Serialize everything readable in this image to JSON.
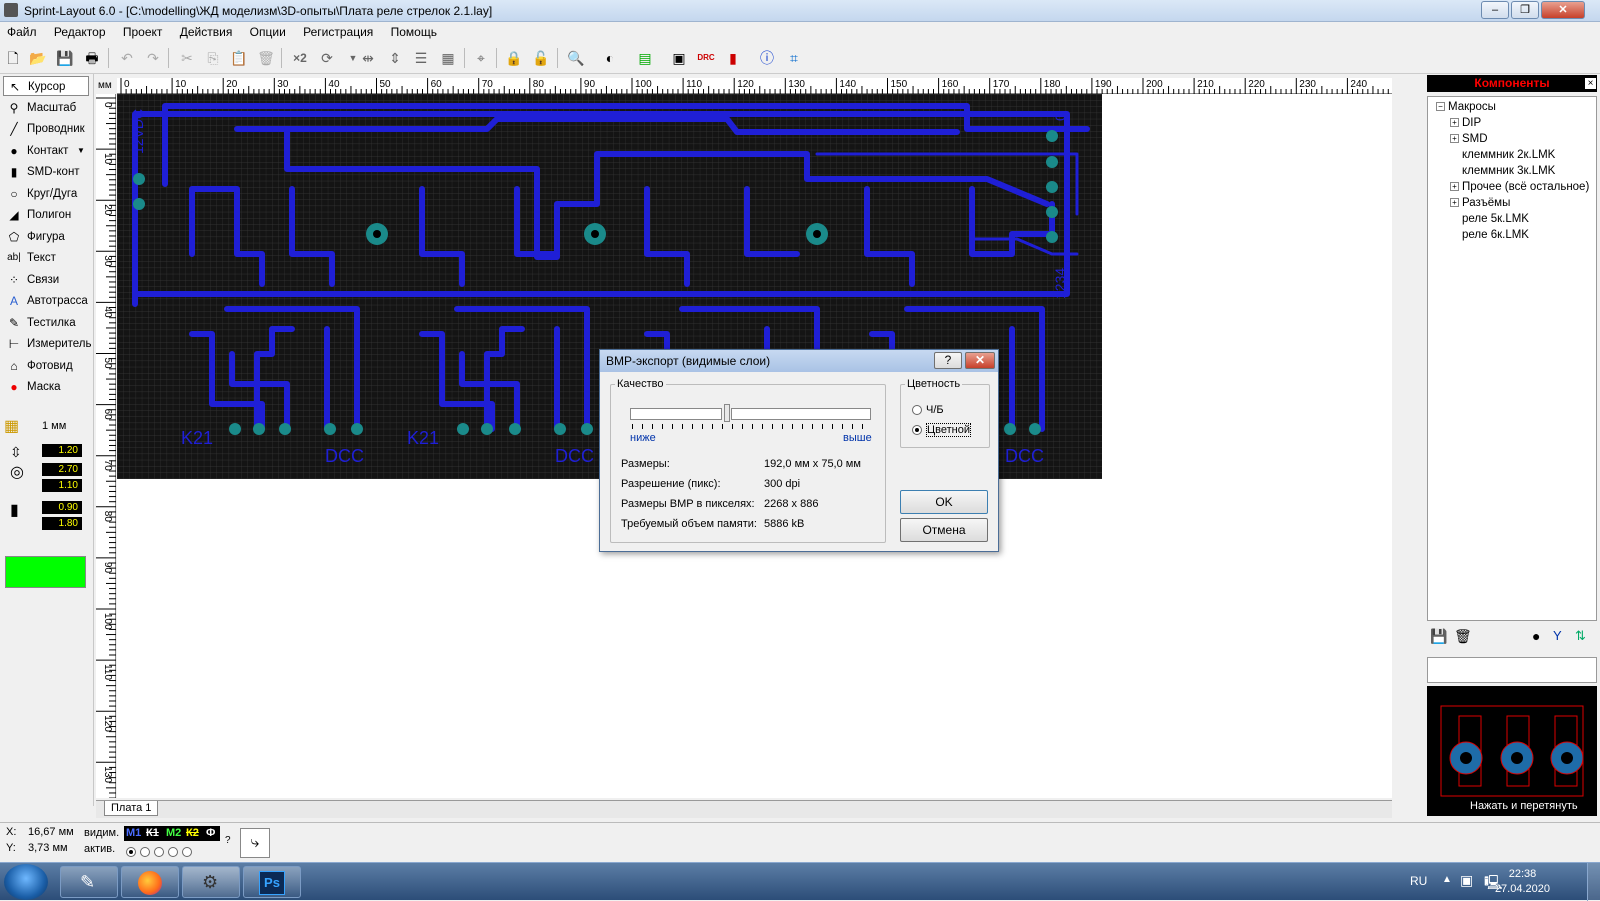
{
  "window": {
    "title": "Sprint-Layout 6.0 - [C:\\modelling\\ЖД моделизм\\3D-опыты\\Плата реле стрелок 2.1.lay]"
  },
  "menu": [
    "Файл",
    "Редактор",
    "Проект",
    "Действия",
    "Опции",
    "Регистрация",
    "Помощь"
  ],
  "toolbar": {
    "x2_label": "×2"
  },
  "tools": [
    "Курсор",
    "Масштаб",
    "Проводник",
    "Контакт",
    "SMD-конт",
    "Круг/Дуга",
    "Полигон",
    "Фигура",
    "Текст",
    "Связи",
    "Автотрасса",
    "Тестилка",
    "Измеритель",
    "Фотовид",
    "Маска"
  ],
  "grid": {
    "value": "1 мм"
  },
  "dims": {
    "d1": "1.20",
    "d2": "2.70",
    "d3": "1.10",
    "d4": "0.90",
    "d5": "1.80"
  },
  "ruler": {
    "unit": "мм",
    "top_ticks": [
      "0",
      "10",
      "20",
      "30",
      "40",
      "50",
      "60",
      "70",
      "80",
      "90",
      "100",
      "110",
      "120",
      "130",
      "140",
      "150",
      "160",
      "170",
      "180",
      "190",
      "200",
      "210",
      "220",
      "230",
      "240",
      "250"
    ],
    "left_ticks": [
      "0",
      "10",
      "20",
      "30",
      "40",
      "50",
      "60",
      "70",
      "80",
      "90",
      "100",
      "110",
      "120",
      "130"
    ]
  },
  "pcb_labels": {
    "k21_a": "K21",
    "k21_b": "K21",
    "dcc_a": "DCC",
    "dcc_b": "DCC",
    "dcc_c": "DCC",
    "left_label": "12VDC",
    "right_label": "1234",
    "right_top": "0"
  },
  "tabs": {
    "board1": "Плата 1"
  },
  "status": {
    "x_label": "X:",
    "x_value": "16,67 мм",
    "y_label": "Y:",
    "y_value": "3,73 мм",
    "visible_label": "видим.",
    "active_label": "актив.",
    "layers": [
      "М1",
      "К1",
      "М2",
      "К2",
      "Ф"
    ],
    "help": "?"
  },
  "components": {
    "header": "Компоненты",
    "close": "×",
    "tree": [
      {
        "label": "Макросы",
        "level": 0,
        "expander": "−"
      },
      {
        "label": "DIP",
        "level": 1,
        "expander": "+"
      },
      {
        "label": "SMD",
        "level": 1,
        "expander": "+"
      },
      {
        "label": "клеммник 2к.LMK",
        "level": 1,
        "expander": ""
      },
      {
        "label": "клеммник 3к.LMK",
        "level": 1,
        "expander": ""
      },
      {
        "label": "Прочее (всё остальное)",
        "level": 1,
        "expander": "+"
      },
      {
        "label": "Разъёмы",
        "level": 1,
        "expander": "+"
      },
      {
        "label": "реле 5к.LMK",
        "level": 1,
        "expander": ""
      },
      {
        "label": "реле 6к.LMK",
        "level": 1,
        "expander": ""
      }
    ],
    "preview_hint": "Нажать и перетянуть"
  },
  "dialog": {
    "title": "BMP-экспорт (видимые слои)",
    "help_btn": "?",
    "close_btn": "✕",
    "quality_legend": "Качество",
    "lower": "ниже",
    "higher": "выше",
    "color_legend": "Цветность",
    "bw": "Ч/Б",
    "color": "Цветной",
    "rows": [
      {
        "label": "Размеры:",
        "value": "192,0 мм x 75,0 мм"
      },
      {
        "label": "Разрешение (пикс):",
        "value": "300 dpi"
      },
      {
        "label": "Размеры BMP в пикселях:",
        "value": "2268 x 886"
      },
      {
        "label": "Требуемый объем памяти:",
        "value": "5886 kB"
      }
    ],
    "ok": "OK",
    "cancel": "Отмена"
  },
  "taskbar": {
    "lang": "RU",
    "time": "22:38",
    "date": "27.04.2020",
    "ps_label": "Ps"
  },
  "colors": {
    "pcb_bg": "#141414",
    "track": "#1f1fd6",
    "pad": "#1a8a8a",
    "highlight_green": "#00ff00"
  }
}
